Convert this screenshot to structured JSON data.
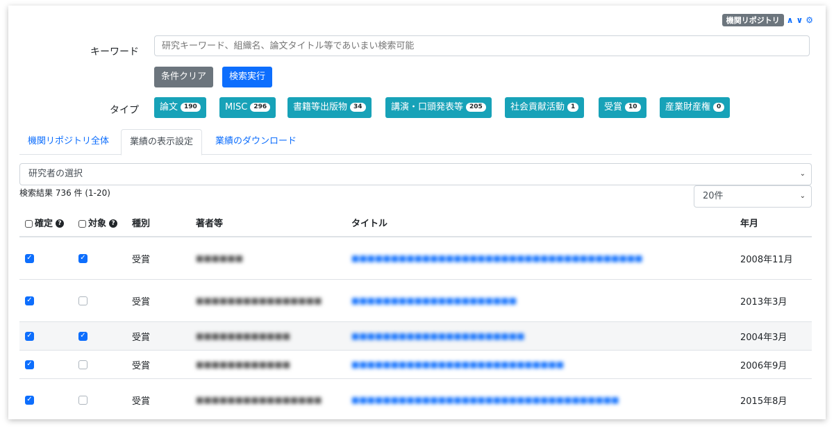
{
  "header": {
    "repo_badge": "機関リポジトリ",
    "up_icon": "chevron-up",
    "down_icon": "chevron-down",
    "settings_icon": "gear"
  },
  "search": {
    "keyword_label": "キーワード",
    "keyword_placeholder": "研究キーワード、組織名、論文タイトル等であいまい検索可能",
    "clear_label": "条件クリア",
    "search_label": "検索実行"
  },
  "types": {
    "label": "タイプ",
    "items": [
      {
        "label": "論文",
        "count": "190"
      },
      {
        "label": "MISC",
        "count": "296"
      },
      {
        "label": "書籍等出版物",
        "count": "34"
      },
      {
        "label": "講演・口頭発表等",
        "count": "205"
      },
      {
        "label": "社会貢献活動",
        "count": "1"
      },
      {
        "label": "受賞",
        "count": "10"
      },
      {
        "label": "産業財産権",
        "count": "0"
      }
    ]
  },
  "tabs": [
    "機関リポジトリ全体",
    "業績の表示設定",
    "業績のダウンロード"
  ],
  "researcher_select": "研究者の選択",
  "result_summary": "検索結果 736 件 (1-20)",
  "page_size": "20件",
  "table": {
    "headers": {
      "confirm": "確定",
      "target": "対象",
      "kind": "種別",
      "authors": "著者等",
      "title": "タイトル",
      "date": "年月"
    },
    "rows": [
      {
        "confirm": true,
        "target": true,
        "kind": "受賞",
        "authors": "■■■■■■",
        "title": "■■■■■■■■■■■■■■■■■■■■■■■■■■■■■■■■■■■■■",
        "date": "2008年11月"
      },
      {
        "confirm": true,
        "target": false,
        "kind": "受賞",
        "authors": "■■■■■■■■■■■■■■■■",
        "title": "■■■■■■■■■■■■■■■■■■■■■",
        "date": "2013年3月"
      },
      {
        "confirm": true,
        "target": true,
        "kind": "受賞",
        "authors": "■■■■■■■■■■■■",
        "title": "■■■■■■■■■■■■■■■■■■■■■■",
        "date": "2004年3月"
      },
      {
        "confirm": true,
        "target": false,
        "kind": "受賞",
        "authors": "■■■■■■■■■■■■",
        "title": "■■■■■■■■■■■■■■■■■■■■■■■■■■■",
        "date": "2006年9月"
      },
      {
        "confirm": true,
        "target": false,
        "kind": "受賞",
        "authors": "■■■■■■■■■■■■■■■■",
        "title": "■■■■■■■■■■■■■■■■■■■■■■■■■■■■■■■■■■",
        "date": "2015年8月"
      }
    ]
  },
  "colors": {
    "primary": "#0d6efd",
    "secondary": "#6c757d",
    "info": "#17a2b8"
  }
}
